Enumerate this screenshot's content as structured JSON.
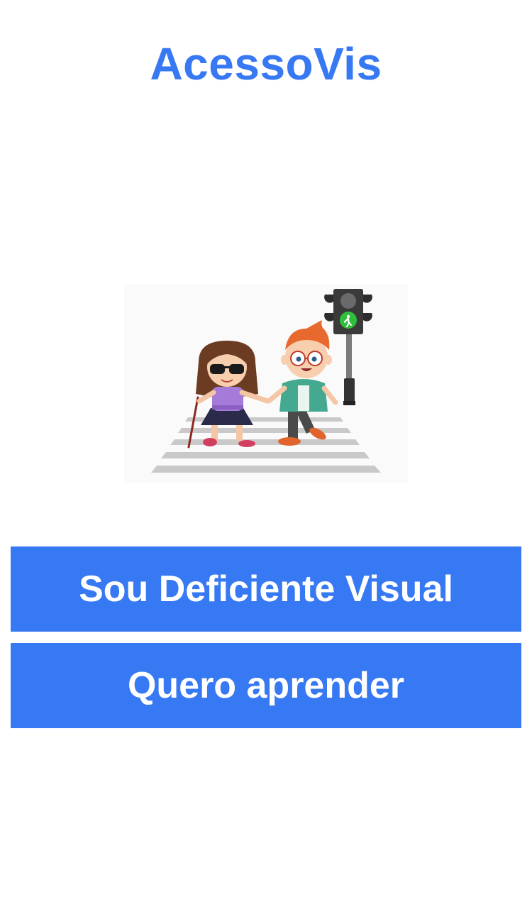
{
  "app": {
    "title": "AcessoVis"
  },
  "illustration": {
    "subject": "crosswalk-children-illustration",
    "traffic_light_state": "green-pedestrian"
  },
  "buttons": {
    "visually_impaired_label": "Sou Deficiente Visual",
    "learn_label": "Quero aprender"
  },
  "colors": {
    "brand_blue": "#3778F3",
    "background": "#FFFFFF",
    "button_text": "#FFFFFF"
  }
}
